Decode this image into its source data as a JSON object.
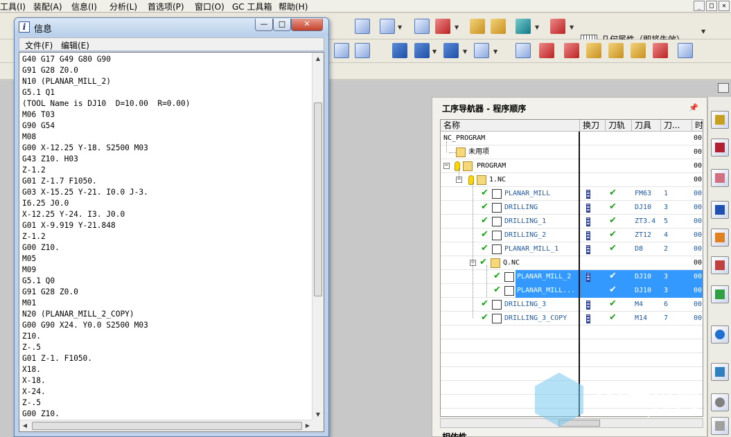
{
  "menubar": {
    "items": [
      "工具(I)",
      "装配(A)",
      "信息(I)",
      "分析(L)",
      "首选项(P)",
      "窗口(O)",
      "GC 工具箱",
      "帮助(H)"
    ],
    "window_buttons": [
      "_",
      "□",
      "✕"
    ]
  },
  "toolbar": {
    "geometry_property_label": "几何属性（即将失效）...",
    "close_symbol": "✕"
  },
  "dialog": {
    "title": "信息",
    "title_icon": "i",
    "buttons": [
      "—",
      "□",
      "✕"
    ],
    "menu": [
      "文件(F)",
      "编辑(E)"
    ],
    "lines": [
      "G40 G17 G49 G80 G90",
      "G91 G28 Z0.0",
      "N10 (PLANAR_MILL_2)",
      "G5.1 Q1",
      "(TOOL Name is DJ10  D=10.00  R=0.00)",
      "M06 T03",
      "G90 G54",
      "M08",
      "G00 X-12.25 Y-18. S2500 M03",
      "G43 Z10. H03",
      "Z-1.2",
      "G01 Z-1.7 F1050.",
      "G03 X-15.25 Y-21. I0.0 J-3.",
      "I6.25 J0.0",
      "X-12.25 Y-24. I3. J0.0",
      "G01 X-9.919 Y-21.848",
      "Z-1.2",
      "G00 Z10.",
      "M05",
      "M09",
      "G5.1 Q0",
      "G91 G28 Z0.0",
      "M01",
      "N20 (PLANAR_MILL_2_COPY)",
      "G00 G90 X24. Y0.0 S2500 M03",
      "Z10.",
      "Z-.5",
      "G01 Z-1. F1050.",
      "X18.",
      "X-18.",
      "X-24.",
      "Z-.5",
      "G00 Z10."
    ],
    "scroll_arrows": {
      "up": "▲",
      "down": "▼",
      "left": "◀",
      "right": "▶"
    }
  },
  "navigator": {
    "title": "工序导航器 - 程序顺序",
    "pin_icon": "pin-icon",
    "columns": [
      "名称",
      "换刀",
      "刀轨",
      "刀具",
      "刀...",
      "时"
    ],
    "rows": [
      {
        "name": "NC_PROGRAM",
        "time": "00"
      },
      {
        "name": "未用项",
        "time": "00"
      },
      {
        "name": "PROGRAM",
        "time": "00"
      },
      {
        "name": "1.NC",
        "time": "00"
      },
      {
        "name": "PLANAR_MILL",
        "tool": "FM63",
        "num": "1",
        "time": "00"
      },
      {
        "name": "DRILLING",
        "tool": "DJ10",
        "num": "3",
        "time": "00"
      },
      {
        "name": "DRILLING_1",
        "tool": "ZT3.4",
        "num": "5",
        "time": "00"
      },
      {
        "name": "DRILLING_2",
        "tool": "ZT12",
        "num": "4",
        "time": "00"
      },
      {
        "name": "PLANAR_MILL_1",
        "tool": "D8",
        "num": "2",
        "time": "00"
      },
      {
        "name": "Q.NC",
        "time": "00"
      },
      {
        "name": "PLANAR_MILL_2",
        "tool": "DJ10",
        "num": "3",
        "time": "00"
      },
      {
        "name": "PLANAR_MILL...",
        "tool": "DJ10",
        "num": "3",
        "time": "00"
      },
      {
        "name": "DRILLING_3",
        "tool": "M4",
        "num": "6",
        "time": "00"
      },
      {
        "name": "DRILLING_3_COPY",
        "tool": "M14",
        "num": "7",
        "time": "00"
      }
    ],
    "dependencies_label": "相依性",
    "expander_minus": "−"
  },
  "watermark": {
    "text": "3D世界网",
    "url": "WWW.3DSJW.COM"
  },
  "colors": {
    "selection": "#3399ff",
    "check": "#1aa31a",
    "tool_link": "#1d5aa6"
  }
}
